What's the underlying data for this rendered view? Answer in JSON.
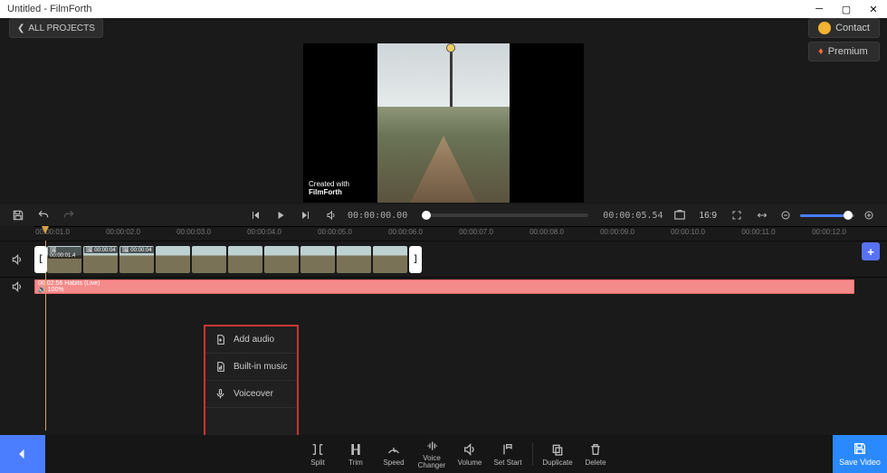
{
  "titlebar": {
    "title": "Untitled - FilmForth"
  },
  "toprow": {
    "all_projects": "ALL PROJECTS",
    "contact": "Contact",
    "premium": "Premium"
  },
  "watermark": {
    "line1": "Created with",
    "line2": "FilmForth"
  },
  "playback": {
    "current": "00:00:00.00",
    "total": "00:00:05.54",
    "ratio": "16:9"
  },
  "ruler": [
    "00:00:01.0",
    "00:00:02.0",
    "00:00:03.0",
    "00:00:04.0",
    "00:00:05.0",
    "00:00:06.0",
    "00:00:07.0",
    "00:00:08.0",
    "00:00:09.0",
    "00:00:10.0",
    "00:00:11.0",
    "00:00:12.0"
  ],
  "video_thumbs": [
    {
      "overlay": "🖼 00:00:01.4"
    },
    {
      "overlay": "🖼 00:00:04"
    },
    {
      "overlay": "🖼 00:00:04"
    },
    {
      "overlay": ""
    },
    {
      "overlay": ""
    },
    {
      "overlay": ""
    },
    {
      "overlay": ""
    },
    {
      "overlay": ""
    },
    {
      "overlay": ""
    },
    {
      "overlay": ""
    }
  ],
  "audio_clip": {
    "line1": "00:02:56  Habits (Live)",
    "line2": "🔊 100%"
  },
  "popup": {
    "item1": "Add audio",
    "item2": "Built-in music",
    "item3": "Voiceover",
    "bottom": "Add audio"
  },
  "tools": {
    "split": "Split",
    "trim": "Trim",
    "speed": "Speed",
    "voice_changer": "Voice\nChanger",
    "volume": "Volume",
    "set_start": "Set Start",
    "duplicate": "Duplicate",
    "delete": "Delete"
  },
  "save": "Save Video"
}
